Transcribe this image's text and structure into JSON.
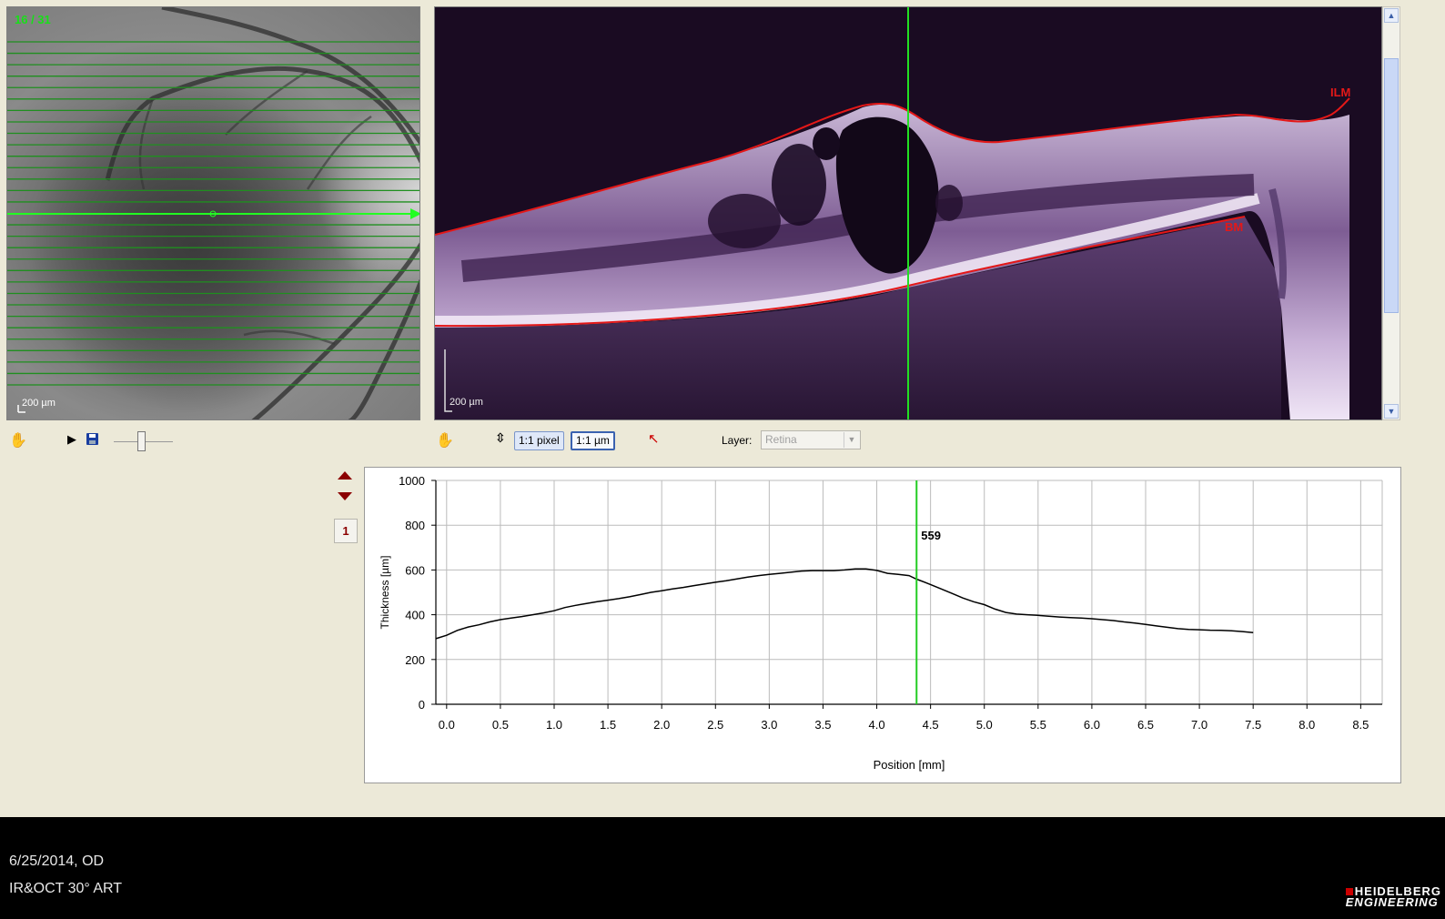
{
  "fundus": {
    "scan_counter": "16 / 31",
    "scale_label": "200 µm",
    "scan_lines_total": 31,
    "active_scan": 16
  },
  "oct": {
    "scale_label": "200 µm",
    "labels": {
      "ilm": "ILM",
      "bm": "BM"
    }
  },
  "toolbar_left": {
    "icons": [
      "hand-icon",
      "play-icon",
      "save-icon",
      "slider"
    ]
  },
  "toolbar_right": {
    "btn_1to1_pixel": "1:1 pixel",
    "btn_1to1_um": "1:1 µm",
    "layer_label": "Layer:",
    "layer_value": "Retina"
  },
  "side": {
    "page_number": "1"
  },
  "chart_data": {
    "type": "line",
    "xlabel": "Position [mm]",
    "ylabel": "Thickness [µm]",
    "xlim": [
      -0.1,
      8.7
    ],
    "ylim": [
      0,
      1000
    ],
    "x_ticks": [
      "0.0",
      "0.5",
      "1.0",
      "1.5",
      "2.0",
      "2.5",
      "3.0",
      "3.5",
      "4.0",
      "4.5",
      "5.0",
      "5.5",
      "6.0",
      "6.5",
      "7.0",
      "7.5",
      "8.0",
      "8.5"
    ],
    "y_ticks": [
      "0",
      "200",
      "400",
      "600",
      "800",
      "1000"
    ],
    "grid": true,
    "cursor": {
      "x": 4.37,
      "value_label": "559"
    },
    "series": [
      {
        "x": [
          -0.1,
          0.0,
          0.1,
          0.2,
          0.3,
          0.4,
          0.5,
          0.6,
          0.7,
          0.8,
          0.9,
          1.0,
          1.1,
          1.2,
          1.3,
          1.4,
          1.5,
          1.6,
          1.7,
          1.8,
          1.9,
          2.0,
          2.1,
          2.2,
          2.3,
          2.4,
          2.5,
          2.6,
          2.7,
          2.8,
          2.9,
          3.0,
          3.1,
          3.2,
          3.3,
          3.4,
          3.5,
          3.6,
          3.7,
          3.8,
          3.9,
          4.0,
          4.1,
          4.2,
          4.3,
          4.37,
          4.5,
          4.6,
          4.7,
          4.8,
          4.9,
          5.0,
          5.1,
          5.2,
          5.3,
          5.4,
          5.5,
          5.6,
          5.7,
          5.8,
          5.9,
          6.0,
          6.1,
          6.2,
          6.3,
          6.4,
          6.5,
          6.6,
          6.7,
          6.8,
          6.9,
          7.0,
          7.1,
          7.2,
          7.3,
          7.4,
          7.5
        ],
        "values": [
          293,
          308,
          330,
          345,
          355,
          368,
          378,
          385,
          392,
          400,
          408,
          418,
          432,
          442,
          450,
          458,
          465,
          472,
          480,
          490,
          500,
          507,
          515,
          522,
          530,
          538,
          545,
          552,
          560,
          568,
          575,
          580,
          585,
          590,
          595,
          597,
          597,
          597,
          600,
          605,
          605,
          598,
          585,
          580,
          575,
          559,
          535,
          515,
          495,
          475,
          458,
          445,
          425,
          410,
          403,
          400,
          397,
          393,
          390,
          387,
          385,
          382,
          378,
          374,
          368,
          363,
          357,
          350,
          344,
          338,
          334,
          333,
          331,
          330,
          328,
          325,
          320
        ]
      }
    ]
  },
  "footer": {
    "date_eye": "6/25/2014, OD",
    "modality": "IR&OCT 30° ART",
    "logo_line1": "HEIDELBERG",
    "logo_line2": "ENGINEERING"
  }
}
